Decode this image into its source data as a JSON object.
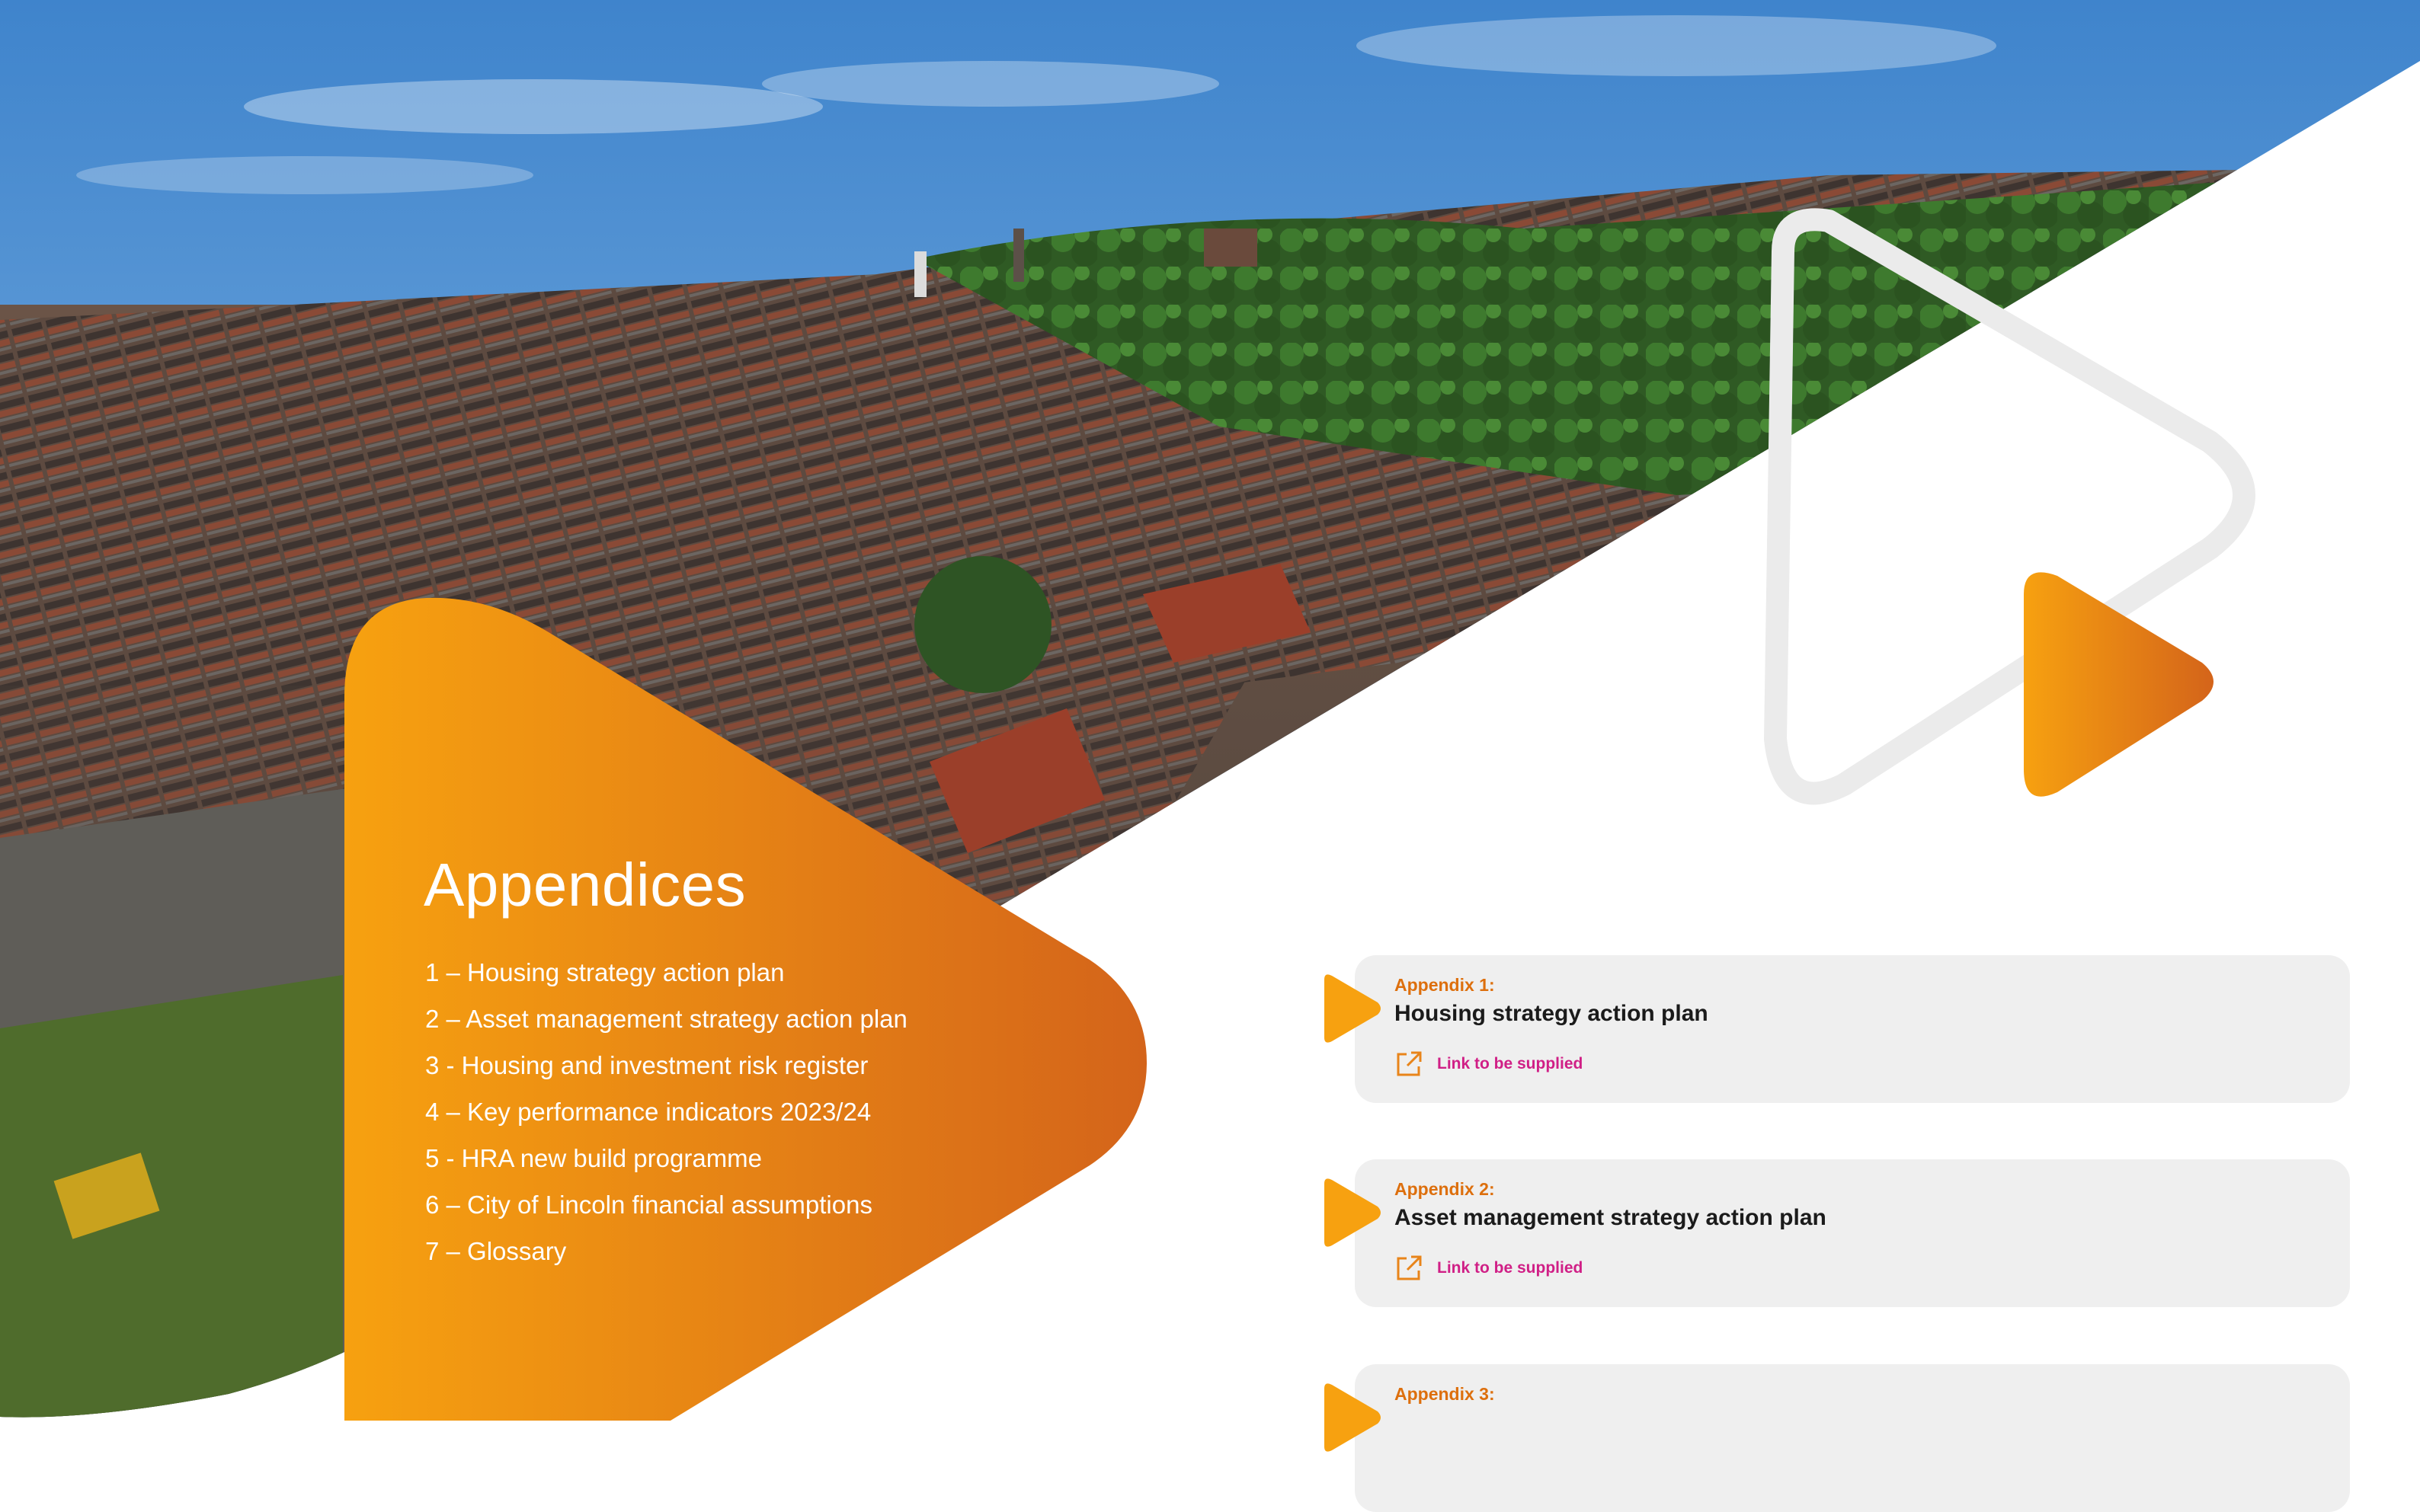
{
  "colors": {
    "orange_light": "#f7a110",
    "orange_dark": "#d4641a",
    "link_pink": "#d01f86",
    "card_bg": "#efefef",
    "sky": "#5b97d4"
  },
  "hero_image": {
    "subject": "aerial view of terraced housing estate"
  },
  "appendices": {
    "title": "Appendices",
    "items": [
      "1 – Housing strategy action plan",
      "2 – Asset management strategy action plan",
      "3 - Housing and investment risk register",
      "4 – Key performance indicators 2023/24",
      "5 - HRA new build programme",
      "6 – City of Lincoln financial assumptions",
      "7 – Glossary"
    ]
  },
  "cards": [
    {
      "label": "Appendix 1:",
      "title": "Housing strategy action plan",
      "link": "Link to be supplied",
      "icon": "external-link-icon"
    },
    {
      "label": "Appendix 2:",
      "title": "Asset management strategy action plan",
      "link": "Link to be supplied",
      "icon": "external-link-icon"
    },
    {
      "label": "Appendix 3:",
      "title": "",
      "link": "",
      "icon": "external-link-icon"
    }
  ]
}
